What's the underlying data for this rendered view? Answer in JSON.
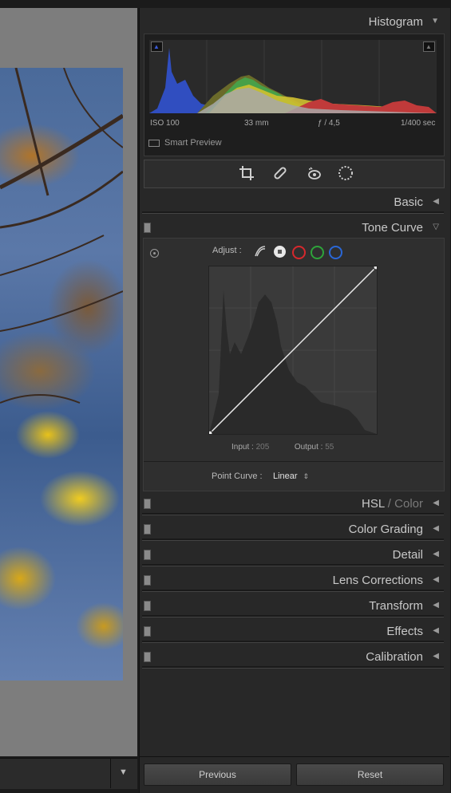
{
  "histogram": {
    "title": "Histogram",
    "exif": {
      "iso": "ISO 100",
      "focal": "33 mm",
      "aperture": "ƒ / 4,5",
      "shutter": "1/400 sec"
    },
    "smart_preview": "Smart Preview"
  },
  "panels": {
    "basic": "Basic",
    "tone_curve": "Tone Curve",
    "hsl": "HSL",
    "hsl_sep": "/",
    "hsl_color": "Color",
    "color_grading": "Color Grading",
    "detail": "Detail",
    "lens_corrections": "Lens Corrections",
    "transform": "Transform",
    "effects": "Effects",
    "calibration": "Calibration"
  },
  "tone_curve": {
    "adjust_label": "Adjust :",
    "input_label": "Input :",
    "input_value": "205",
    "output_label": "Output :",
    "output_value": "55",
    "point_curve_label": "Point Curve :",
    "point_curve_value": "Linear",
    "channels": [
      "white-point",
      "red",
      "green",
      "blue"
    ]
  },
  "buttons": {
    "previous": "Previous",
    "reset": "Reset"
  },
  "colors": {
    "panel_bg": "#282828",
    "red": "#d6282d",
    "green": "#2ea33a",
    "blue": "#2a67d6"
  }
}
